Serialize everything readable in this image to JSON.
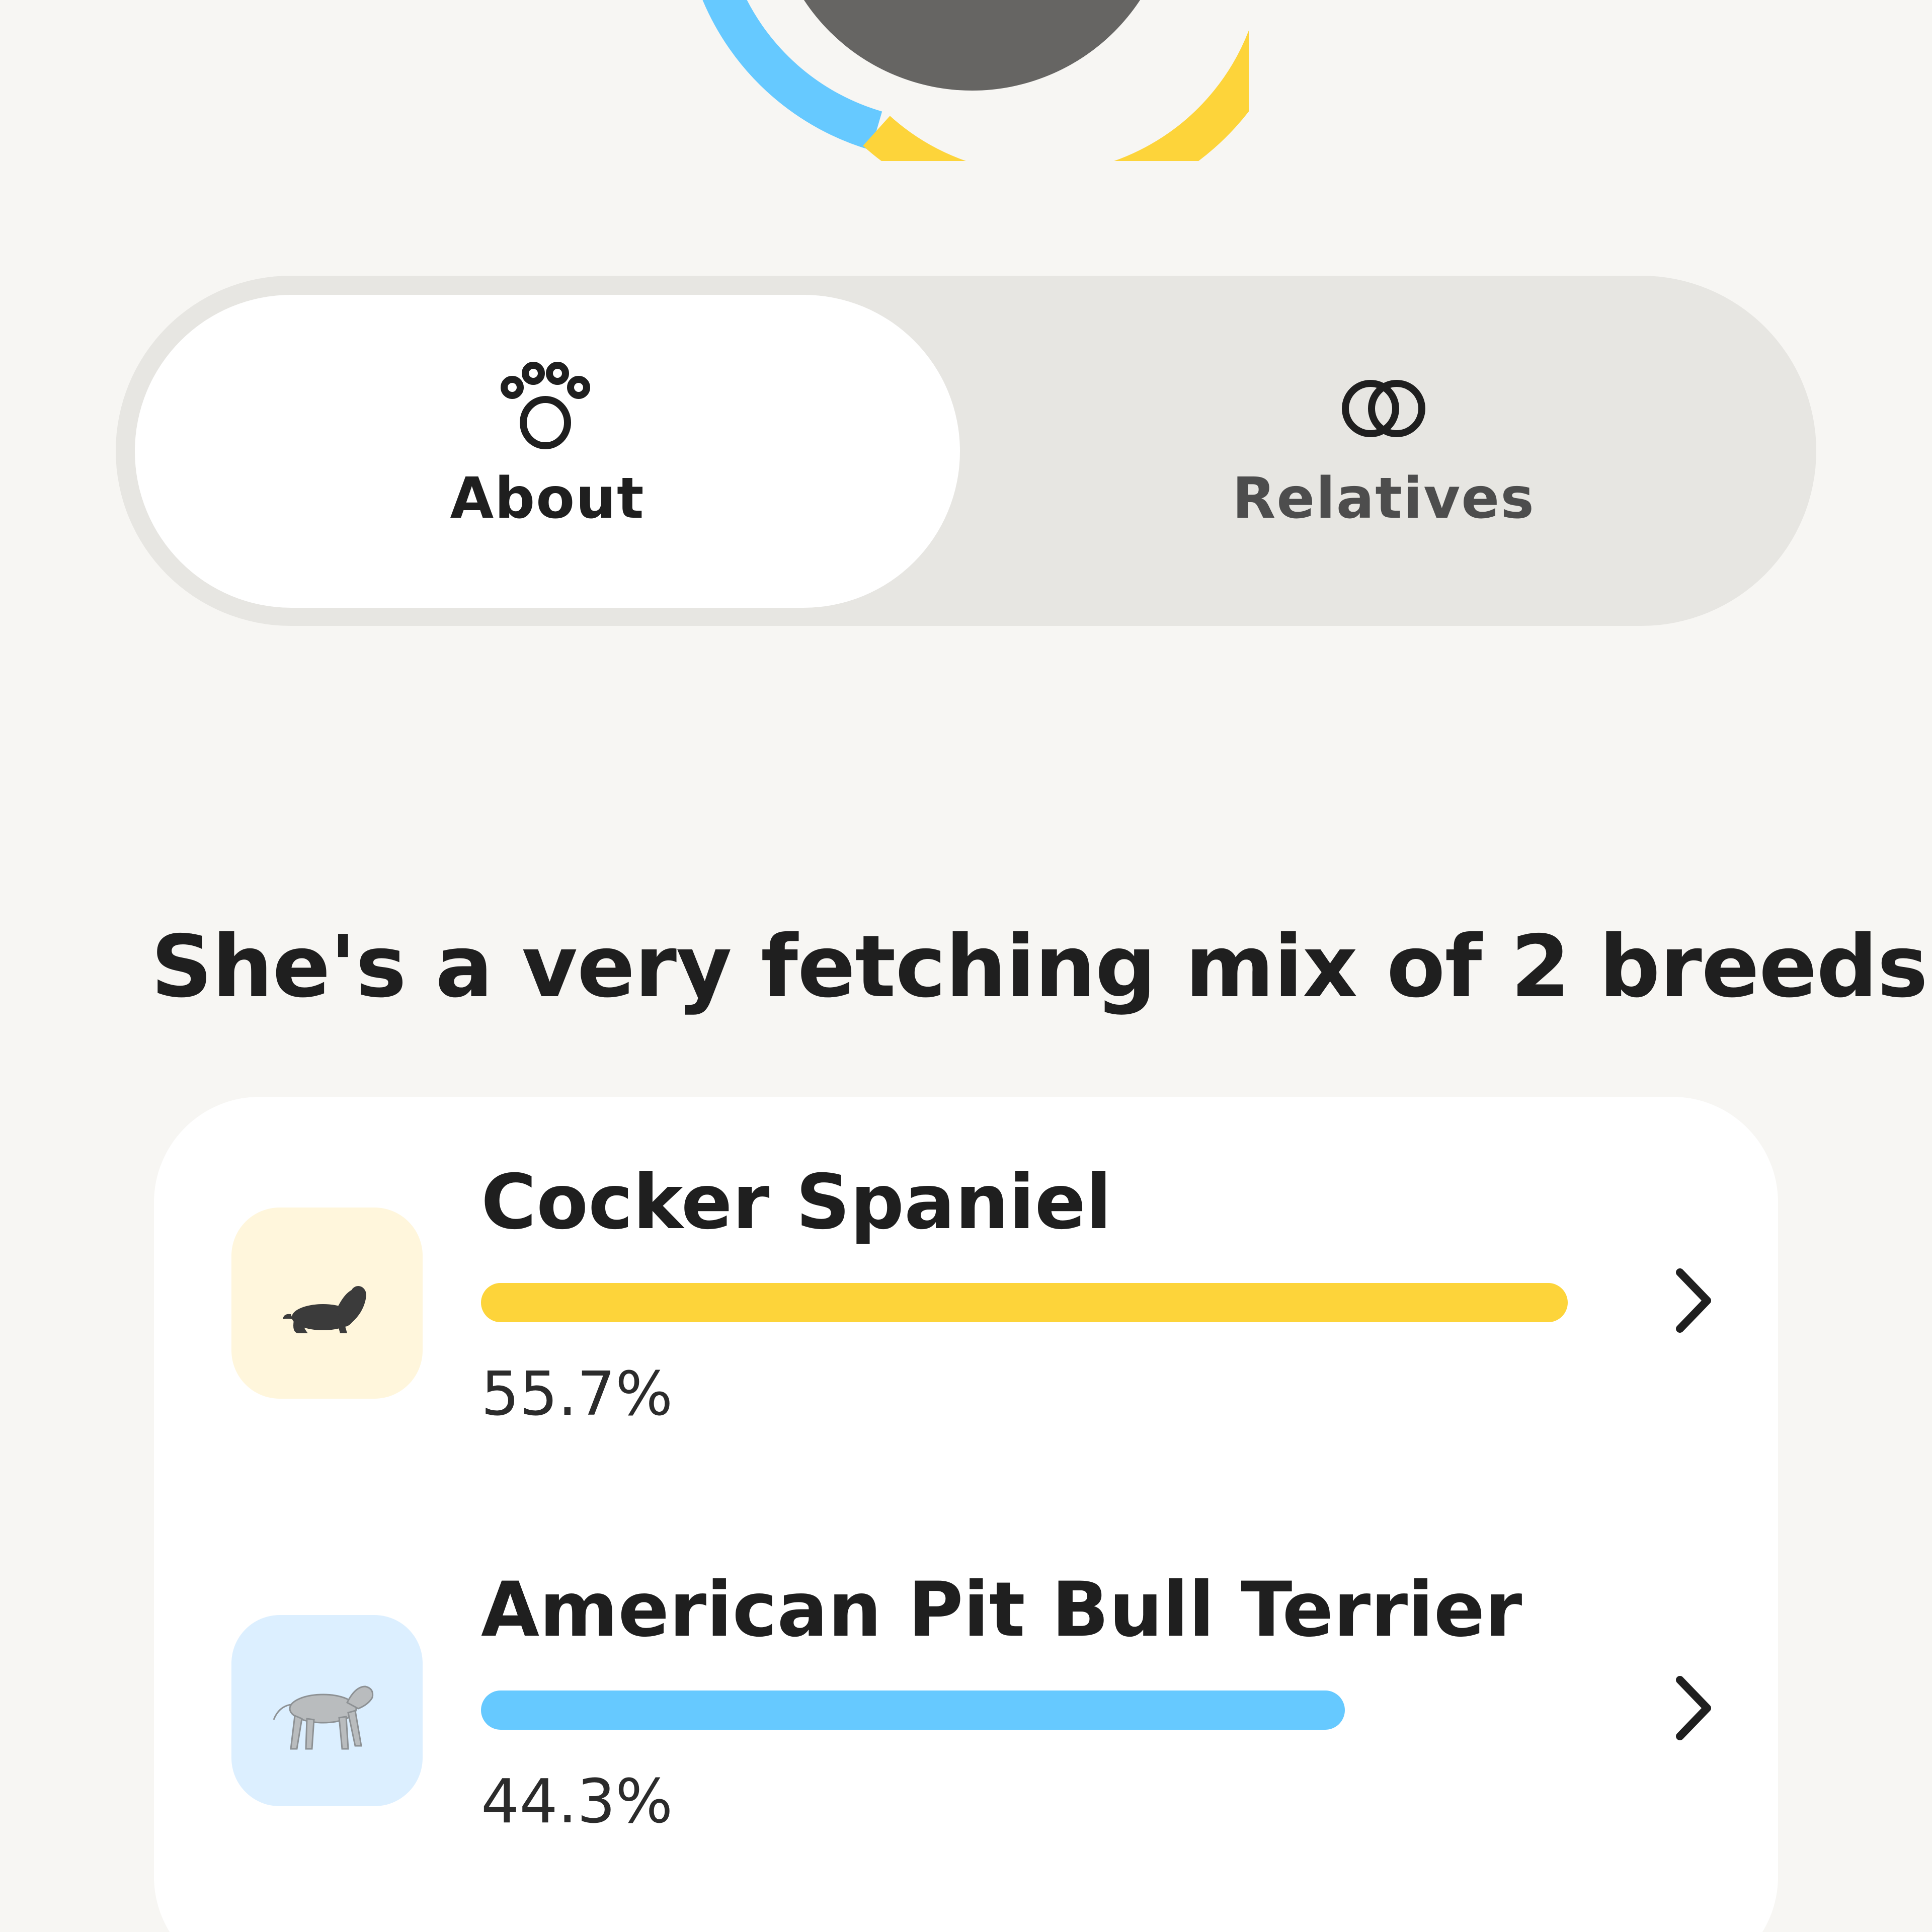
{
  "profile": {
    "avatar_ring_colors": [
      "#fdd43a",
      "#66c9ff"
    ],
    "avatar_fill": "#666563"
  },
  "tabs": [
    {
      "label": "About",
      "icon": "paw-icon",
      "active": true
    },
    {
      "label": "Relatives",
      "icon": "linked-rings-icon",
      "active": false
    }
  ],
  "breed_summary": {
    "headline": "She's a very fetching mix of 2 breeds"
  },
  "breeds": [
    {
      "name": "Cocker Spaniel",
      "percent_label": "55.7%",
      "percent": 55.7,
      "bar_fraction": 1.0,
      "color": "#fdd43a",
      "thumb_bg": "#fff6dc",
      "icon": "cocker-spaniel-icon"
    },
    {
      "name": "American Pit Bull Terrier",
      "percent_label": "44.3%",
      "percent": 44.3,
      "bar_fraction": 0.795,
      "color": "#66c9ff",
      "thumb_bg": "#dcefff",
      "icon": "pit-bull-icon"
    }
  ]
}
